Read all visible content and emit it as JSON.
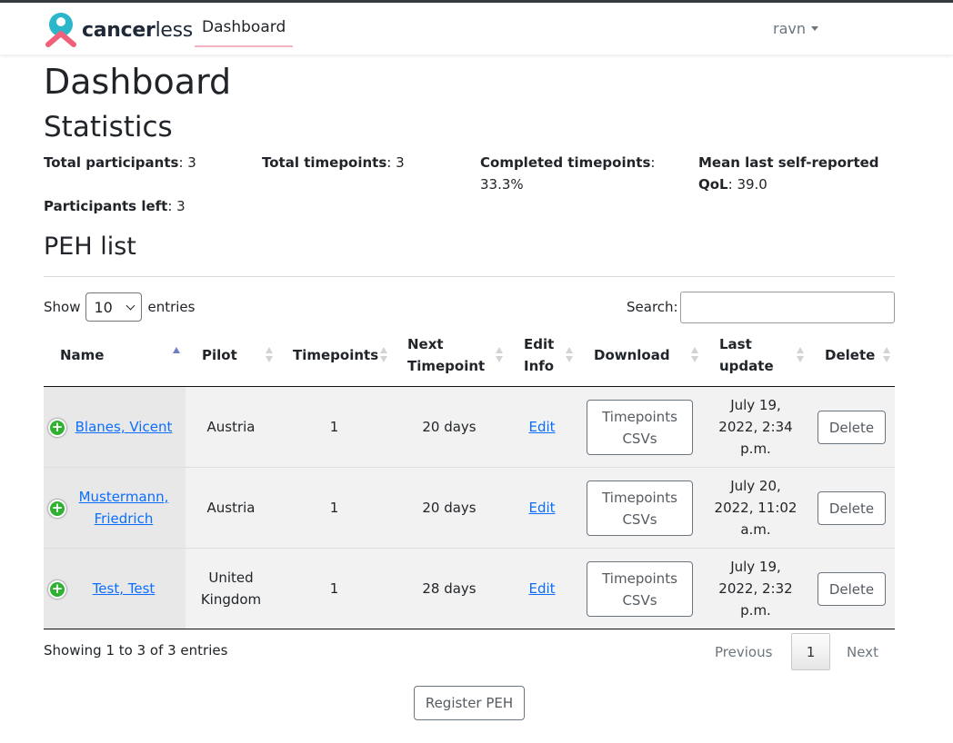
{
  "navbar": {
    "brand_bold": "cancer",
    "brand_light": "less",
    "nav_item": "Dashboard",
    "user": "ravn"
  },
  "page": {
    "title": "Dashboard"
  },
  "statistics": {
    "title": "Statistics",
    "total_participants_label": "Total participants",
    "total_participants_value": ": 3",
    "total_timepoints_label": "Total timepoints",
    "total_timepoints_value": ": 3",
    "completed_timepoints_label": "Completed timepoints",
    "completed_timepoints_value": ": 33.3%",
    "mean_qol_label_1": "Mean last self-reported",
    "mean_qol_label_2": "QoL",
    "mean_qol_value": ": 39.0",
    "participants_left_label": "Participants left",
    "participants_left_value": ": 3"
  },
  "peh": {
    "title": "PEH list",
    "show_label": "Show",
    "entries_value": "10",
    "entries_label": "entries",
    "search_label": "Search:",
    "search_value": "",
    "columns": [
      {
        "line1": "Name",
        "line2": ""
      },
      {
        "line1": "Pilot",
        "line2": ""
      },
      {
        "line1": "Timepoints",
        "line2": ""
      },
      {
        "line1": "Next",
        "line2": "Timepoint"
      },
      {
        "line1": "Edit",
        "line2": "Info"
      },
      {
        "line1": "Download",
        "line2": ""
      },
      {
        "line1": "Last",
        "line2": "update"
      },
      {
        "line1": "Delete",
        "line2": ""
      }
    ],
    "rows": [
      {
        "name_1": "Blanes, Vicent",
        "name_2": "",
        "pilot_1": "Austria",
        "pilot_2": "",
        "timepoints": "1",
        "next": "20 days",
        "edit": "Edit",
        "download_1": "Timepoints",
        "download_2": "CSVs",
        "update_1": "July 19,",
        "update_2": "2022, 2:34",
        "update_3": "p.m.",
        "delete": "Delete"
      },
      {
        "name_1": "Mustermann,",
        "name_2": "Friedrich",
        "pilot_1": "Austria",
        "pilot_2": "",
        "timepoints": "1",
        "next": "20 days",
        "edit": "Edit",
        "download_1": "Timepoints",
        "download_2": "CSVs",
        "update_1": "July 20,",
        "update_2": "2022, 11:02",
        "update_3": "a.m.",
        "delete": "Delete"
      },
      {
        "name_1": "Test, Test",
        "name_2": "",
        "pilot_1": "United",
        "pilot_2": "Kingdom",
        "timepoints": "1",
        "next": "28 days",
        "edit": "Edit",
        "download_1": "Timepoints",
        "download_2": "CSVs",
        "update_1": "July 19,",
        "update_2": "2022, 2:32",
        "update_3": "p.m.",
        "delete": "Delete"
      }
    ],
    "info": "Showing 1 to 3 of 3 entries",
    "pagination": {
      "previous": "Previous",
      "current": "1",
      "next": "Next"
    },
    "register_button": "Register PEH"
  }
}
